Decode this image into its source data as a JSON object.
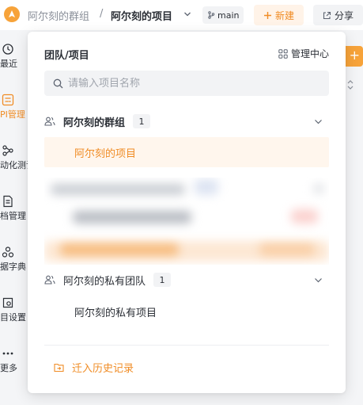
{
  "header": {
    "breadcrumb_group": "阿尔刻的群组",
    "breadcrumb_separator": "/",
    "breadcrumb_project": "阿尔刻的项目",
    "branch": "main",
    "new_label": "新建",
    "share_label": "分享"
  },
  "sidebar": {
    "items": [
      {
        "label": "最近",
        "icon": "history-icon",
        "active": false
      },
      {
        "label": "PI管理",
        "icon": "api-icon",
        "active": true
      },
      {
        "label": "动化测试",
        "icon": "automation-icon",
        "active": false
      },
      {
        "label": "档管理",
        "icon": "document-icon",
        "active": false
      },
      {
        "label": "据字典",
        "icon": "dictionary-icon",
        "active": false
      },
      {
        "label": "目设置",
        "icon": "settings-icon",
        "active": false
      },
      {
        "label": "更多",
        "icon": "more-icon",
        "active": false
      }
    ]
  },
  "right_edge": {
    "add_glyph": "+"
  },
  "dropdown": {
    "title": "团队/项目",
    "manage_label": "管理中心",
    "search_placeholder": "请输入项目名称",
    "groups": [
      {
        "name": "阿尔刻的群组",
        "count": "1",
        "expanded": true,
        "projects": [
          {
            "name": "阿尔刻的项目",
            "selected": true
          }
        ]
      },
      {
        "name": "阿尔刻的私有团队",
        "count": "1",
        "expanded": true,
        "projects": [
          {
            "name": "阿尔刻的私有项目",
            "selected": false
          }
        ]
      }
    ],
    "history_label": "迁入历史记录"
  },
  "colors": {
    "accent": "#f08c25",
    "accent_light": "#fff6ed",
    "logo": "#f7a33a"
  }
}
